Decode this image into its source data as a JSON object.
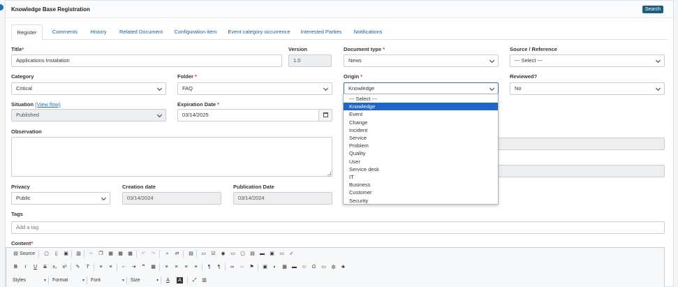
{
  "header": {
    "title": "Knowledge Base Registration",
    "search_label": "Search"
  },
  "tabs": [
    {
      "label": "Register",
      "active": true
    },
    {
      "label": "Comments"
    },
    {
      "label": "History"
    },
    {
      "label": "Related Document"
    },
    {
      "label": "Configuration item"
    },
    {
      "label": "Event category occurrence"
    },
    {
      "label": "Interested Parties"
    },
    {
      "label": "Notifications"
    }
  ],
  "form": {
    "title": {
      "label": "Title",
      "required_mark": "*",
      "value": "Applications Instalation"
    },
    "version": {
      "label": "Version",
      "value": "1.0"
    },
    "document_type": {
      "label": "Document type",
      "required_mark": " *",
      "value": "News"
    },
    "source_reference": {
      "label": "Source / Reference",
      "value": "--- Select ---"
    },
    "category": {
      "label": "Category",
      "value": "Critical"
    },
    "folder": {
      "label": "Folder",
      "required_mark": " *",
      "value": "FAQ"
    },
    "origin": {
      "label": "Origin",
      "required_mark": " *",
      "value": "Knowledge"
    },
    "reviewed": {
      "label": "Reviewed?",
      "value": "No"
    },
    "situation": {
      "label": "Situation",
      "view_flow": "(View flow)",
      "value": "Published"
    },
    "expiration_date": {
      "label": "Expiration Date",
      "required_mark": " *",
      "value": "03/14/2025"
    },
    "observation": {
      "label": "Observation"
    },
    "privacy": {
      "label": "Privacy",
      "value": "Public"
    },
    "creation_date": {
      "label": "Creation date",
      "value": "03/14/2024"
    },
    "publication_date": {
      "label": "Publication Date",
      "value": "03/14/2024"
    },
    "tags": {
      "label": "Tags",
      "placeholder": "Add a tag"
    },
    "content": {
      "label": "Content",
      "required_mark": "*"
    }
  },
  "origin_dropdown": {
    "selected_index": 1,
    "options": [
      "--- Select ---",
      "Knowledge",
      "Event",
      "Change",
      "Incident",
      "Service",
      "Problem",
      "Quality",
      "User",
      "Service desk",
      "IT",
      "Business",
      "Customer",
      "Security"
    ]
  },
  "editor": {
    "source_label": "Source",
    "combos": {
      "styles": "Styles",
      "format": "Format",
      "font": "Font",
      "size": "Size"
    },
    "glyphs": {
      "bold": "B",
      "italic": "I",
      "underline": "U",
      "strike": "S",
      "subscript": "x₂",
      "superscript": "x²",
      "blockquote": "❞",
      "omega": "Ω",
      "text_color": "A",
      "bg_color": "A"
    }
  },
  "colors": {
    "accent": "#1f6fb5",
    "search_button": "#1b5e7e",
    "selected_option": "#1f66c8",
    "required": "#d9363e"
  }
}
